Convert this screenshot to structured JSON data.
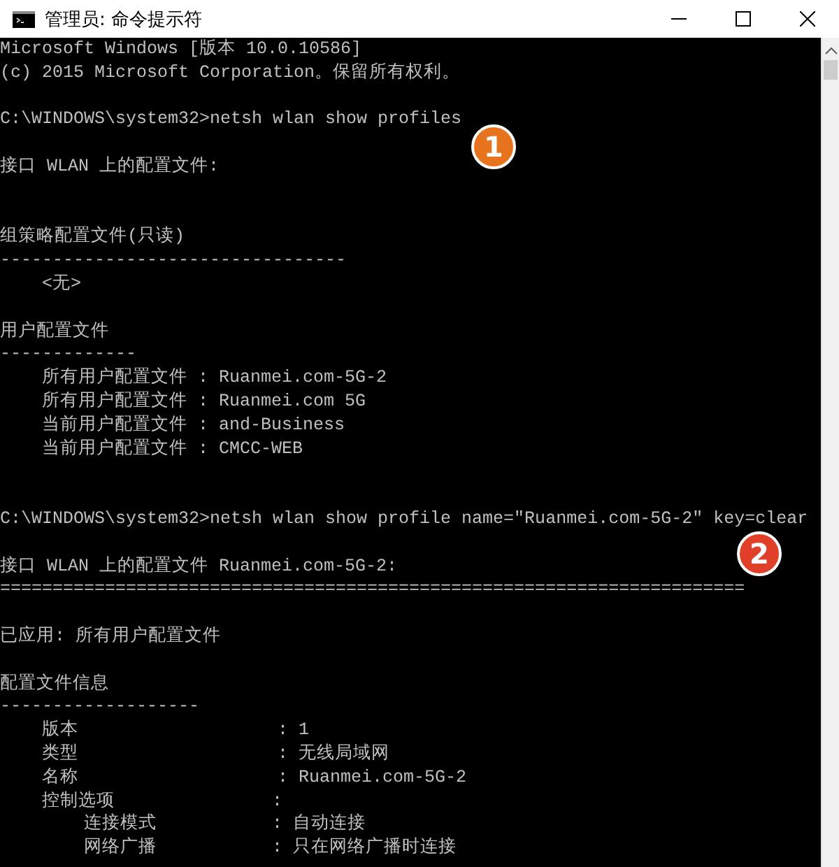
{
  "window": {
    "title": "管理员: 命令提示符"
  },
  "console": {
    "lines": [
      {
        "kind": "text",
        "text": "Microsoft Windows [版本 10.0.10586]"
      },
      {
        "kind": "text",
        "text": "(c) 2015 Microsoft Corporation。保留所有权利。"
      },
      {
        "kind": "blank"
      },
      {
        "kind": "text",
        "text": "C:\\WINDOWS\\system32>netsh wlan show profiles"
      },
      {
        "kind": "blank"
      },
      {
        "kind": "text",
        "text": "接口 WLAN 上的配置文件:"
      },
      {
        "kind": "blank"
      },
      {
        "kind": "blank"
      },
      {
        "kind": "text",
        "text": "组策略配置文件(只读)"
      },
      {
        "kind": "text",
        "text": "---------------------------------"
      },
      {
        "kind": "text",
        "text": "    <无>"
      },
      {
        "kind": "blank"
      },
      {
        "kind": "text",
        "text": "用户配置文件"
      },
      {
        "kind": "text",
        "text": "-------------"
      },
      {
        "kind": "text",
        "text": "    所有用户配置文件 : Ruanmei.com-5G-2"
      },
      {
        "kind": "text",
        "text": "    所有用户配置文件 : Ruanmei.com 5G"
      },
      {
        "kind": "text",
        "text": "    当前用户配置文件 : and-Business"
      },
      {
        "kind": "text",
        "text": "    当前用户配置文件 : CMCC-WEB"
      },
      {
        "kind": "blank"
      },
      {
        "kind": "blank"
      },
      {
        "kind": "text",
        "text": "C:\\WINDOWS\\system32>netsh wlan show profile name=\"Ruanmei.com-5G-2\" key=clear"
      },
      {
        "kind": "blank"
      },
      {
        "kind": "text",
        "text": "接口 WLAN 上的配置文件 Ruanmei.com-5G-2:"
      },
      {
        "kind": "text",
        "text": "======================================================================="
      },
      {
        "kind": "blank"
      },
      {
        "kind": "text",
        "text": "已应用: 所有用户配置文件"
      },
      {
        "kind": "blank"
      },
      {
        "kind": "text",
        "text": "配置文件信息"
      },
      {
        "kind": "text",
        "text": "-------------------"
      },
      {
        "kind": "text",
        "text": "    版本                   : 1"
      },
      {
        "kind": "text",
        "text": "    类型                   : 无线局域网"
      },
      {
        "kind": "text",
        "text": "    名称                   : Ruanmei.com-5G-2"
      },
      {
        "kind": "text",
        "text": "    控制选项               :"
      },
      {
        "kind": "text",
        "text": "        连接模式           : 自动连接"
      },
      {
        "kind": "text",
        "text": "        网络广播           : 只在网络广播时连接"
      }
    ]
  },
  "callouts": [
    {
      "text": "1",
      "color": "#e8731f"
    },
    {
      "text": "2",
      "color": "#e0402a"
    }
  ]
}
